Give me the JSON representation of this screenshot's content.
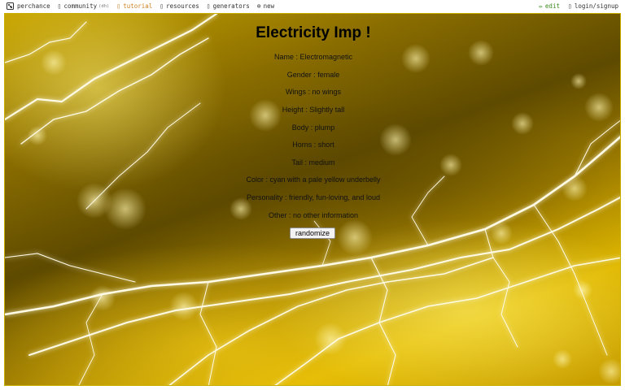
{
  "nav": {
    "left": [
      {
        "label": "perchance",
        "icon": "dice-icon"
      },
      {
        "label": "community",
        "icon": "chat-icon",
        "tag": "(dh)"
      },
      {
        "label": "tutorial",
        "icon": "book-icon"
      },
      {
        "label": "resources",
        "icon": "folder-icon"
      },
      {
        "label": "generators",
        "icon": "grid-icon"
      },
      {
        "label": "new",
        "icon": "plus-circle-icon"
      }
    ],
    "right": [
      {
        "label": "edit",
        "icon": "pencil-icon"
      },
      {
        "label": "login/signup",
        "icon": "user-icon"
      }
    ]
  },
  "generator": {
    "title": "Electricity Imp !",
    "lines": [
      "Name : Electromagnetic",
      "Gender : female",
      "Wings : no wings",
      "Height : Slightly tall",
      "Body : plump",
      "Horns : short",
      "Tail : medium",
      "Color : cyan with a pale yellow underbelly",
      "Personality : friendly, fun-loving, and loud",
      "Other : no other information"
    ],
    "button_label": "randomize"
  },
  "colors": {
    "accent_tutorial": "#d08020",
    "accent_edit": "#3a8a1a",
    "background_yellow": "#e0b800"
  }
}
